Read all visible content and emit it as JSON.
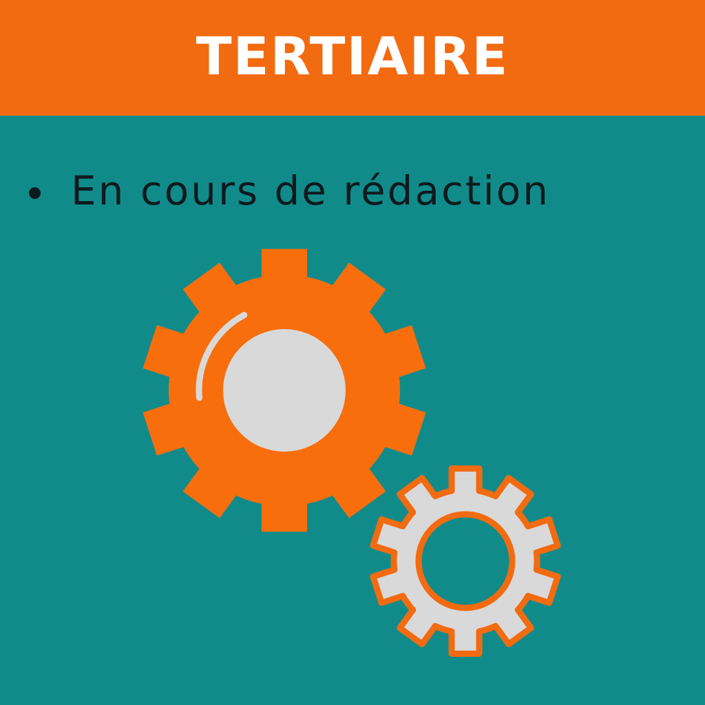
{
  "banner": {
    "title": "TERTIAIRE"
  },
  "status": {
    "items": [
      "En cours de rédaction"
    ]
  },
  "colors": {
    "background": "#118b8a",
    "banner": "#f26b10",
    "gear_large": "#f86e0c",
    "gear_small_fill": "#d9d9d9",
    "gear_small_outline": "#f26b10",
    "hub": "#d9d9d9"
  },
  "icons": [
    "large-gear-icon",
    "small-gear-icon"
  ]
}
